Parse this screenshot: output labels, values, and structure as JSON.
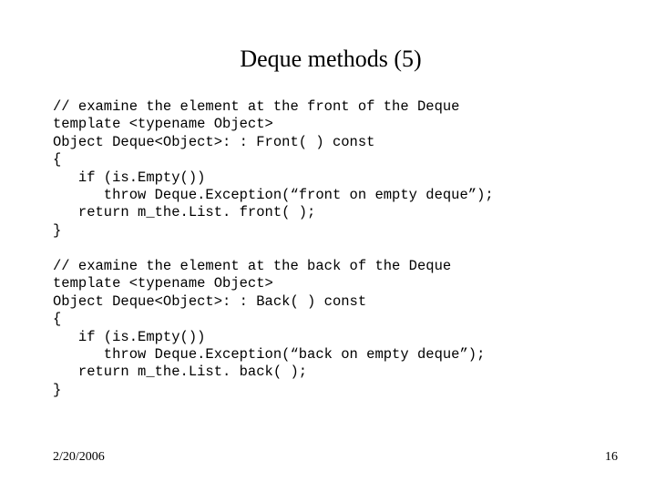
{
  "title": "Deque methods (5)",
  "code_block_1": "// examine the element at the front of the Deque\ntemplate <typename Object>\nObject Deque<Object>: : Front( ) const\n{\n   if (is.Empty())\n      throw Deque.Exception(“front on empty deque”);\n   return m_the.List. front( );\n}",
  "code_block_2": "// examine the element at the back of the Deque\ntemplate <typename Object>\nObject Deque<Object>: : Back( ) const\n{\n   if (is.Empty())\n      throw Deque.Exception(“back on empty deque”);\n   return m_the.List. back( );\n}",
  "footer": {
    "date": "2/20/2006",
    "page": "16"
  }
}
